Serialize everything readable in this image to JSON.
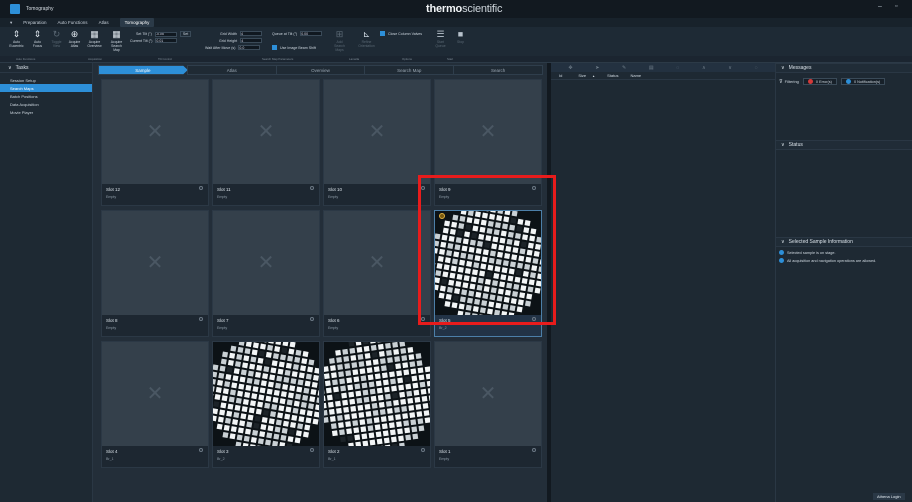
{
  "window": {
    "title": "Tomography",
    "brand_bold": "thermo",
    "brand_light": "scientific",
    "minimize": "–",
    "maximize": "▫"
  },
  "menu": {
    "dropdown": "▾",
    "items": [
      "Preparation",
      "Auto Functions",
      "Atlas"
    ],
    "active": "Tomography"
  },
  "ribbon": {
    "auto_eucentric": "Auto Eucentric",
    "auto_focus": "Auto Focus",
    "toggle_view": "Toggle View",
    "acquire_atlas": "Acquire Atlas",
    "acquire_overview": "Acquire Overview",
    "acquire_search_map": "Acquire Search Map",
    "set_tilt_label": "Set Tilt (°)",
    "set_tilt_value": "-0.05",
    "set_button": "Set",
    "current_tilt_label": "Current Tilt (°)",
    "current_tilt_value": "0.01",
    "grid_width_label": "Grid Width",
    "grid_width_value": "4",
    "grid_height_label": "Grid Height",
    "grid_height_value": "4",
    "wait_label": "Wait After Move (s)",
    "wait_value": "0.0",
    "queue_label": "Queue at Tilt (°)",
    "queue_value": "0.00",
    "use_image_beam_shift": "Use Image Beam Shift",
    "add_search_maps": "Add Search Maps",
    "refine_orientation": "Refine Orientation",
    "close_column_valves": "Close Column Valves",
    "start_queue": "Start Queue",
    "stop": "Stop"
  },
  "ribbon_groups": [
    "Auto Functions",
    "Acquisition",
    "Tilt Control",
    "Search Map Parameters",
    "Lamella",
    "Options",
    "Start"
  ],
  "sidebar": {
    "header": "Tasks",
    "items": [
      "Session Setup",
      "Search Maps",
      "Batch Positions",
      "Data Acquisition",
      "Movie Player"
    ],
    "selected_index": 1
  },
  "wizard": {
    "steps": [
      "Sample",
      "Atlas",
      "Overview",
      "Search Map",
      "Search"
    ],
    "active_index": 0
  },
  "slots": [
    {
      "name": "Slot 12",
      "status": "Empty",
      "has_image": false
    },
    {
      "name": "Slot 11",
      "status": "Empty",
      "has_image": false
    },
    {
      "name": "Slot 10",
      "status": "Empty",
      "has_image": false
    },
    {
      "name": "Slot 9",
      "status": "Empty",
      "has_image": false
    },
    {
      "name": "Slot 8",
      "status": "Empty",
      "has_image": false
    },
    {
      "name": "Slot 7",
      "status": "Empty",
      "has_image": false
    },
    {
      "name": "Slot 6",
      "status": "Empty",
      "has_image": false
    },
    {
      "name": "Slot 5",
      "status": "Br_2",
      "has_image": true,
      "selected": true
    },
    {
      "name": "Slot 4",
      "status": "Br_1",
      "has_image": false
    },
    {
      "name": "Slot 3",
      "status": "Br_2",
      "has_image": true
    },
    {
      "name": "Slot 2",
      "status": "Br_1",
      "has_image": true
    },
    {
      "name": "Slot 1",
      "status": "Empty",
      "has_image": false
    }
  ],
  "table": {
    "columns": [
      "Id",
      "Size",
      "Status",
      "Name"
    ],
    "sort_indicator": "▲"
  },
  "messages": {
    "header": "Messages",
    "filtering_label": "Filtering",
    "errors": "0 Error(s)",
    "notifications": "0 Notification(s)"
  },
  "status": {
    "header": "Status"
  },
  "sample_info": {
    "header": "Selected Sample Information",
    "lines": [
      "Selected sample is on stage.",
      "All acquisition and navigation operations are allowed."
    ]
  },
  "footer": {
    "login": "Athena Login"
  },
  "colors": {
    "accent": "#2d8fd8",
    "highlight_box": "#e81c1c",
    "error_dot": "#d43a3a"
  }
}
